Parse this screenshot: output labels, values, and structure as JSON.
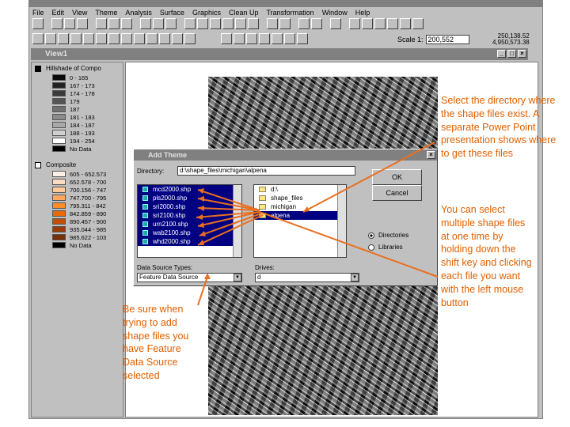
{
  "app": {
    "title": "ArcView GIS 3.2",
    "menu": [
      "File",
      "Edit",
      "View",
      "Theme",
      "Analysis",
      "Surface",
      "Graphics",
      "Clean Up",
      "Transformation",
      "Window",
      "Help"
    ],
    "scale_label": "Scale 1:",
    "scale_value": "200,552",
    "coord_x": "250,138.52",
    "coord_y": "4,950,573.38"
  },
  "view": {
    "title": "View1",
    "themes": [
      {
        "name": "Hillshade of Compo",
        "checked": true,
        "classes": [
          {
            "label": "0 - 165",
            "color": "#0a0a0a"
          },
          {
            "label": "167 - 173",
            "color": "#222"
          },
          {
            "label": "174 - 178",
            "color": "#3a3a3a"
          },
          {
            "label": "179",
            "color": "#555"
          },
          {
            "label": "187",
            "color": "#707070"
          },
          {
            "label": "181 - 183",
            "color": "#8a8a8a"
          },
          {
            "label": "184 - 187",
            "color": "#a8a8a8"
          },
          {
            "label": "188 - 193",
            "color": "#d0d0d0"
          },
          {
            "label": "194 - 254",
            "color": "#ffffff"
          },
          {
            "label": "No Data",
            "color": "#000"
          }
        ]
      },
      {
        "name": "Composite",
        "checked": false,
        "classes": [
          {
            "label": "605 - 652.573",
            "color": "#fff0e6"
          },
          {
            "label": "652.578 - 700",
            "color": "#ffdcc0"
          },
          {
            "label": "700.156 - 747",
            "color": "#ffc896"
          },
          {
            "label": "747.700 - 795",
            "color": "#ffa860"
          },
          {
            "label": "795.311 - 842",
            "color": "#ff8c28"
          },
          {
            "label": "842.859 - 890",
            "color": "#e86a0a"
          },
          {
            "label": "890.457 - 900",
            "color": "#c05008"
          },
          {
            "label": "935.044 - 985",
            "color": "#9a3c06"
          },
          {
            "label": "985.622 - 103",
            "color": "#783006"
          },
          {
            "label": "No Data",
            "color": "#000"
          }
        ]
      }
    ]
  },
  "dialog": {
    "title": "Add Theme",
    "directory_label": "Directory:",
    "directory": "d:\\shape_files\\michigan\\alpena",
    "files": [
      "mcd2000.shp",
      "pls2000.shp",
      "sri2000.shp",
      "sri2100.shp",
      "urn2100.shp",
      "wab2100.shp",
      "whd2000.shp"
    ],
    "folders": [
      "d:\\",
      "shape_files",
      "michigan",
      "alpena"
    ],
    "ok": "OK",
    "cancel": "Cancel",
    "radio": [
      "Directories",
      "Libraries"
    ],
    "dst_label": "Data Source Types:",
    "dst_value": "Feature Data Source",
    "drives_label": "Drives:",
    "drive_value": "d"
  },
  "notes": {
    "directory": "Select the directory where the shape files exist.  A separate Power Point presentation shows where to get these files",
    "multi": "You can select multiple shape files at one time by holding down the shift key and clicking each file you want with the left mouse button",
    "source": "Be sure when trying to add shape files you have Feature Data Source selected"
  }
}
